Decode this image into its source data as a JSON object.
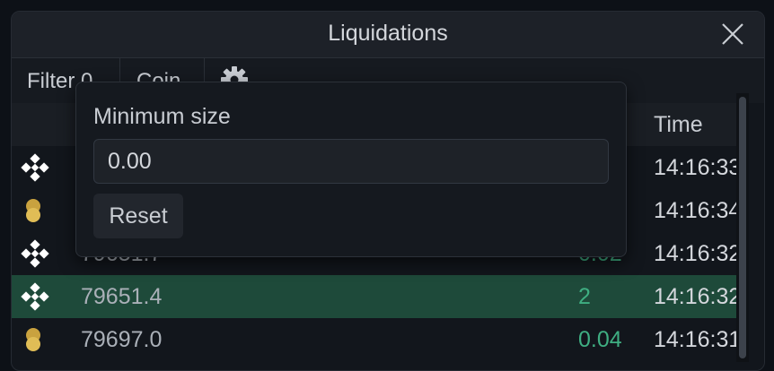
{
  "window": {
    "title": "Liquidations"
  },
  "toolbar": {
    "filter_label": "Filter 0",
    "coin_label": "Coin"
  },
  "table": {
    "time_header": "Time",
    "rows": [
      {
        "coin": "binance",
        "price": "",
        "size": "",
        "time": "14:16:33",
        "highlight": false
      },
      {
        "coin": "gold",
        "price": "",
        "size": "",
        "time": "14:16:34",
        "highlight": false
      },
      {
        "coin": "binance",
        "price": "79651.7",
        "size": "0.02",
        "time": "14:16:32",
        "highlight": false
      },
      {
        "coin": "binance",
        "price": "79651.4",
        "size": "2",
        "time": "14:16:32",
        "highlight": true
      },
      {
        "coin": "gold",
        "price": "79697.0",
        "size": "0.04",
        "time": "14:16:31",
        "highlight": false
      }
    ]
  },
  "popup": {
    "label": "Minimum size",
    "input_value": "0.00",
    "reset_label": "Reset"
  },
  "colors": {
    "highlight_row": "#1e4a3a",
    "size_text": "#3fae82",
    "binance_icon": "#ffffff",
    "gold_icon": "#d9b44a"
  }
}
